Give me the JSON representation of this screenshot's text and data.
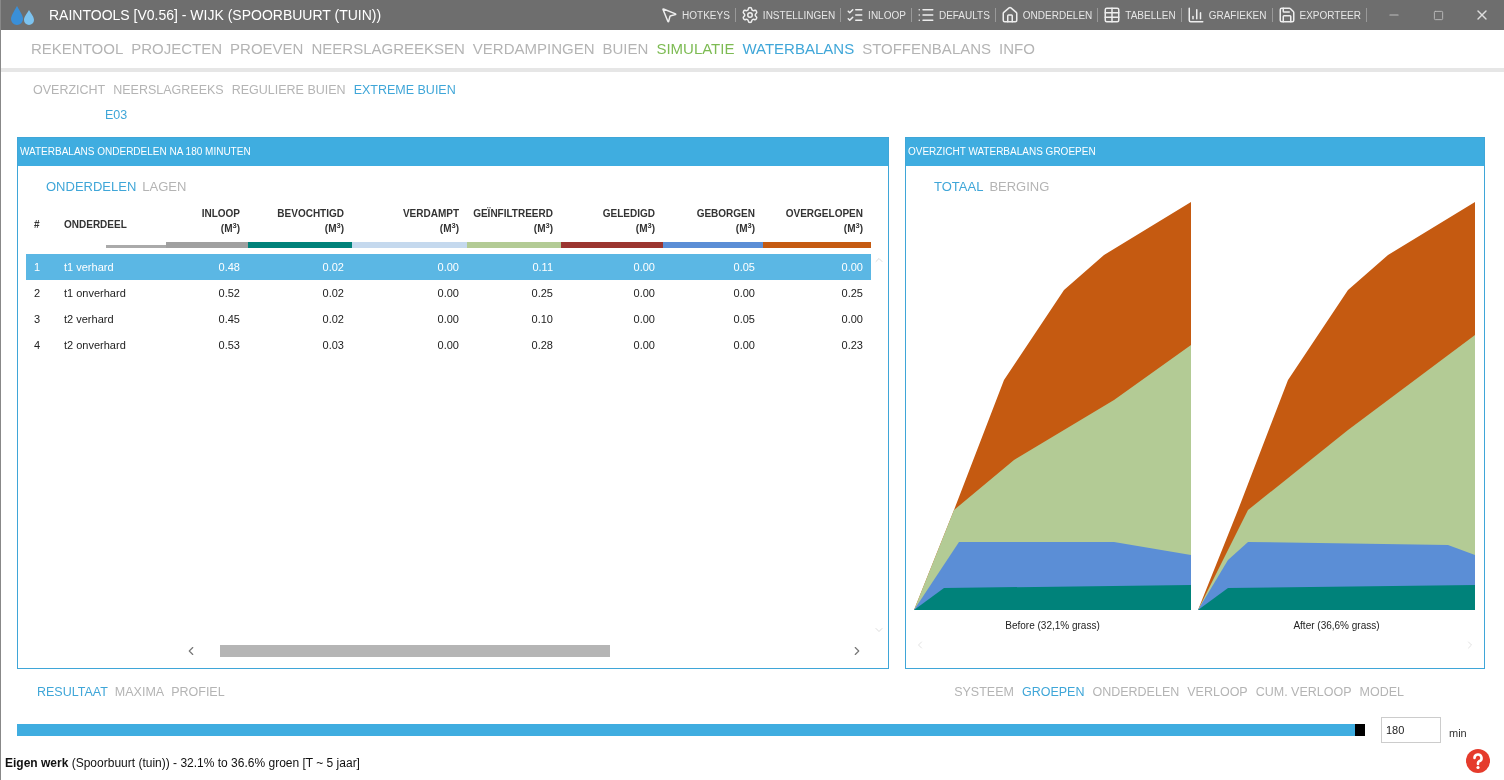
{
  "window": {
    "title": "RAINTOOLS [V0.56] - WIJK (SPOORBUURT (TUIN))"
  },
  "toolbar": [
    "HOTKEYS",
    "INSTELLINGEN",
    "INLOOP",
    "DEFAULTS",
    "ONDERDELEN",
    "TABELLEN",
    "GRAFIEKEN",
    "EXPORTEER"
  ],
  "main_tabs": [
    {
      "label": "REKENTOOL",
      "selected": false,
      "section": false
    },
    {
      "label": "PROJECTEN",
      "selected": false,
      "section": false
    },
    {
      "label": "PROEVEN",
      "selected": false,
      "section": false
    },
    {
      "label": "NEERSLAGREEKSEN",
      "selected": false,
      "section": false
    },
    {
      "label": "VERDAMPINGEN",
      "selected": false,
      "section": false
    },
    {
      "label": "BUIEN",
      "selected": false,
      "section": false
    },
    {
      "label": "SIMULATIE",
      "selected": false,
      "section": true
    },
    {
      "label": "WATERBALANS",
      "selected": true,
      "section": false
    },
    {
      "label": "STOFFENBALANS",
      "selected": false,
      "section": false
    },
    {
      "label": "INFO",
      "selected": false,
      "section": false
    }
  ],
  "sub_tabs": [
    {
      "label": "OVERZICHT",
      "selected": false
    },
    {
      "label": "NEERSLAGREEKS",
      "selected": false
    },
    {
      "label": "REGULIERE BUIEN",
      "selected": false
    },
    {
      "label": "EXTREME BUIEN",
      "selected": true
    }
  ],
  "event_tabs": [
    {
      "label": "E03",
      "selected": true
    }
  ],
  "left_panel": {
    "title": "WATERBALANS ONDERDELEN NA 180 MINUTEN",
    "tabs": [
      {
        "label": "ONDERDELEN",
        "selected": true
      },
      {
        "label": "LAGEN",
        "selected": false
      }
    ],
    "table": {
      "columns": [
        {
          "label": "#"
        },
        {
          "label": "ONDERDEEL"
        },
        {
          "label": "INLOOP",
          "unit": "(M$^{3}$)",
          "color": "#a0a0a0"
        },
        {
          "label": "BEVOCHTIGD",
          "unit": "(M$^{3}$)",
          "color": "#00827a"
        },
        {
          "label": "VERDAMPT",
          "unit": "(M$^{3}$)",
          "color": "#c5d9ee"
        },
        {
          "label": "GEÏNFILTREERD",
          "unit": "(M$^{3}$)",
          "color": "#b3cb95"
        },
        {
          "label": "GELEDIGD",
          "unit": "(M$^{3}$)",
          "color": "#9b3530"
        },
        {
          "label": "GEBORGEN",
          "unit": "(M$^{3}$)",
          "color": "#5b8ed6"
        },
        {
          "label": "OVERGELOPEN",
          "unit": "(M$^{3}$)",
          "color": "#c55a11"
        }
      ],
      "rows": [
        {
          "selected": true,
          "cells": [
            "1",
            "t1 verhard",
            "0.48",
            "0.02",
            "0.00",
            "0.11",
            "0.00",
            "0.05",
            "0.00"
          ]
        },
        {
          "selected": false,
          "cells": [
            "2",
            "t1 onverhard",
            "0.52",
            "0.02",
            "0.00",
            "0.25",
            "0.00",
            "0.00",
            "0.25"
          ]
        },
        {
          "selected": false,
          "cells": [
            "3",
            "t2 verhard",
            "0.45",
            "0.02",
            "0.00",
            "0.10",
            "0.00",
            "0.05",
            "0.00"
          ]
        },
        {
          "selected": false,
          "cells": [
            "4",
            "t2 onverhard",
            "0.53",
            "0.03",
            "0.00",
            "0.28",
            "0.00",
            "0.00",
            "0.23"
          ]
        }
      ]
    },
    "bottom_tabs": [
      {
        "label": "RESULTAAT",
        "selected": true
      },
      {
        "label": "MAXIMA",
        "selected": false
      },
      {
        "label": "PROFIEL",
        "selected": false
      }
    ]
  },
  "right_panel": {
    "title": "OVERZICHT WATERBALANS GROEPEN",
    "tabs": [
      {
        "label": "TOTAAL",
        "selected": true
      },
      {
        "label": "BERGING",
        "selected": false
      }
    ],
    "charts": [
      {
        "caption": "Before (32,1% grass)"
      },
      {
        "caption": "After (36,6% grass)"
      }
    ],
    "bottom_tabs": [
      {
        "label": "SYSTEEM",
        "selected": false
      },
      {
        "label": "GROEPEN",
        "selected": true
      },
      {
        "label": "ONDERDELEN",
        "selected": false
      },
      {
        "label": "VERLOOP",
        "selected": false
      },
      {
        "label": "CUM. VERLOOP",
        "selected": false
      },
      {
        "label": "MODEL",
        "selected": false
      }
    ]
  },
  "time_slider": {
    "level": 1,
    "value": "180",
    "unit": "min"
  },
  "status_bar": "**Eigen werk** (Spoorbuurt (tuin)) - 32.1% to 36.6% groen [T ~ 5 jaar]"
}
